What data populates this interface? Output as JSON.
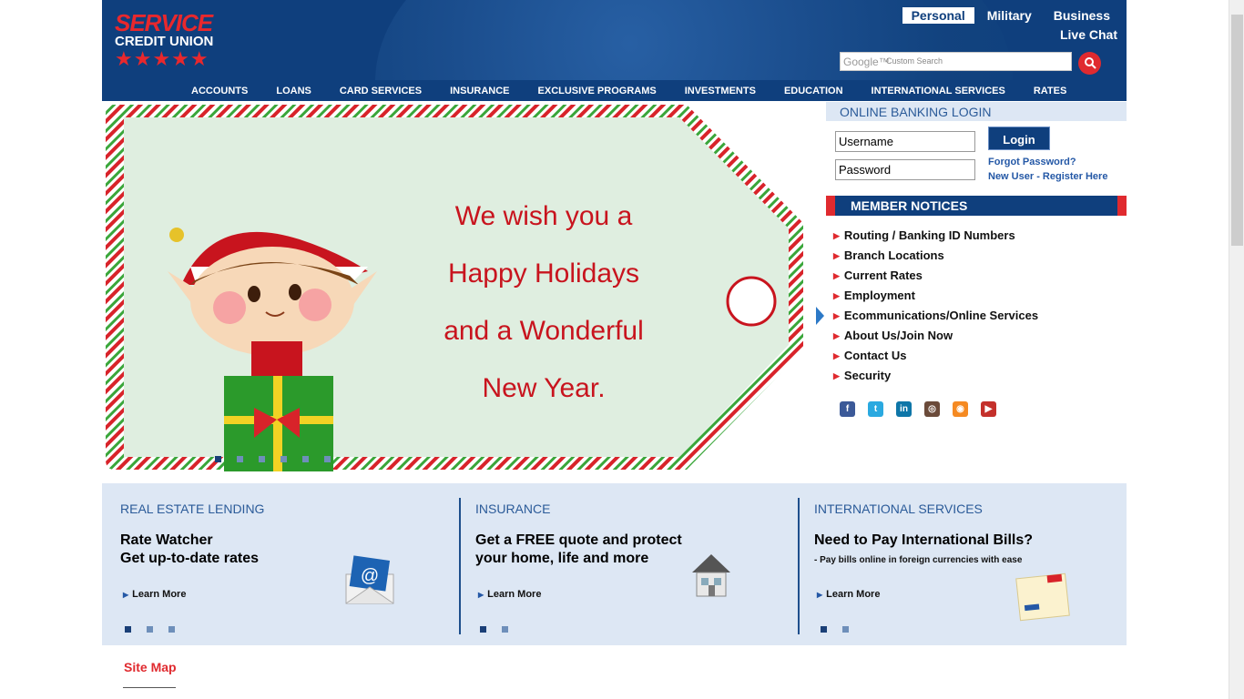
{
  "logo": {
    "line1": "SERVICE",
    "line2": "CREDIT UNION",
    "stars": "★★★★★"
  },
  "segments": [
    {
      "label": "Personal",
      "active": true
    },
    {
      "label": "Military",
      "active": false
    },
    {
      "label": "Business",
      "active": false
    }
  ],
  "live_chat": "Live Chat",
  "search": {
    "brand": "Google™",
    "placeholder": "Custom Search",
    "icon": "search-icon"
  },
  "nav": [
    "ACCOUNTS",
    "LOANS",
    "CARD SERVICES",
    "INSURANCE",
    "EXCLUSIVE PROGRAMS",
    "INVESTMENTS",
    "EDUCATION",
    "INTERNATIONAL SERVICES",
    "RATES"
  ],
  "banner": {
    "lines": [
      "We wish you a",
      "Happy Holidays",
      "and a Wonderful",
      "New Year."
    ],
    "slide_count": 6,
    "active_slide": 0
  },
  "login": {
    "heading": "ONLINE BANKING LOGIN",
    "username_value": "Username",
    "password_value": "Password",
    "button": "Login",
    "forgot": "Forgot Password?",
    "register": "New User - Register Here"
  },
  "notices": {
    "heading": "MEMBER NOTICES",
    "items": [
      "Routing / Banking ID Numbers",
      "Branch Locations",
      "Current Rates",
      "Employment",
      "Ecommunications/Online Services",
      "About Us/Join Now",
      "Contact Us",
      "Security"
    ]
  },
  "social": [
    {
      "name": "facebook-icon",
      "glyph": "f",
      "color": "#3b5998"
    },
    {
      "name": "twitter-icon",
      "glyph": "t",
      "color": "#2aa9e0"
    },
    {
      "name": "linkedin-icon",
      "glyph": "in",
      "color": "#0e76a8"
    },
    {
      "name": "instagram-icon",
      "glyph": "◎",
      "color": "#6b4b3a"
    },
    {
      "name": "rss-icon",
      "glyph": "◉",
      "color": "#f58a22"
    },
    {
      "name": "youtube-icon",
      "glyph": "▶",
      "color": "#c4302b"
    }
  ],
  "promos": [
    {
      "heading": "REAL ESTATE LENDING",
      "headline_1": "Rate Watcher",
      "headline_2": "Get up-to-date rates",
      "sub": "",
      "learn_more": "Learn More",
      "dots": 3
    },
    {
      "heading": "INSURANCE",
      "headline_1": "Get a FREE quote and protect",
      "headline_2": "your home, life and more",
      "sub": "",
      "learn_more": "Learn More",
      "dots": 2
    },
    {
      "heading": "INTERNATIONAL SERVICES",
      "headline_1": "Need to Pay International Bills?",
      "headline_2": "",
      "sub": "- Pay bills online in foreign currencies with ease",
      "learn_more": "Learn More",
      "dots": 2
    }
  ],
  "site_map": "Site Map",
  "colors": {
    "brand_blue": "#0f3f7d",
    "brand_red": "#e02a2f",
    "panel": "#dde7f4"
  }
}
